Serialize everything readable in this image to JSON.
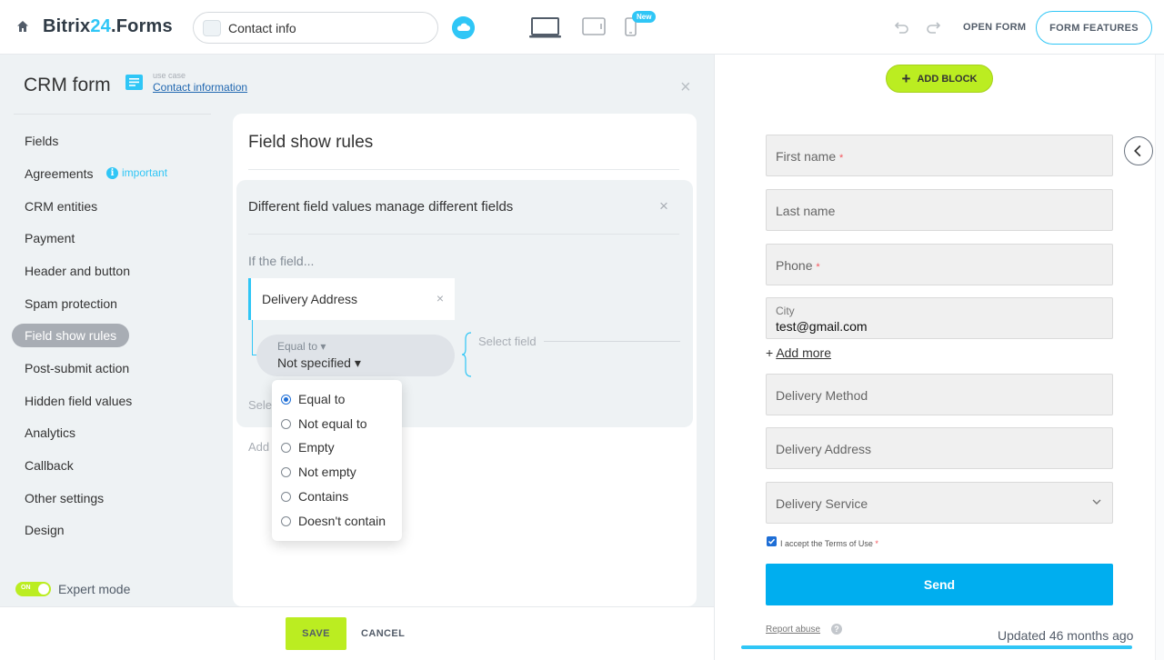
{
  "app": {
    "logo_main": "Bitrix",
    "logo_accent": "24",
    "logo_suffix": ".Forms",
    "form_name": "Contact info",
    "new_badge": "New",
    "open_form": "OPEN FORM",
    "form_features": "FORM FEATURES"
  },
  "panel": {
    "title": "CRM form",
    "usecase_label": "use case",
    "usecase_link": "Contact information",
    "close": "×"
  },
  "nav": {
    "items": [
      {
        "label": "Fields"
      },
      {
        "label": "Agreements"
      },
      {
        "label": "CRM entities"
      },
      {
        "label": "Payment"
      },
      {
        "label": "Header and button"
      },
      {
        "label": "Spam protection"
      },
      {
        "label": "Field show rules"
      },
      {
        "label": "Post-submit action"
      },
      {
        "label": "Hidden field values"
      },
      {
        "label": "Analytics"
      },
      {
        "label": "Callback"
      },
      {
        "label": "Other settings"
      },
      {
        "label": "Design"
      }
    ],
    "active_index": 6,
    "important_icon": "i",
    "important": "important",
    "expert_toggle": "ON",
    "expert_mode": "Expert mode"
  },
  "rules": {
    "title": "Field show rules",
    "block_title": "Different field values manage different fields",
    "block_close": "×",
    "if_field": "If the field...",
    "field_name": "Delivery Address",
    "field_remove": "×",
    "operator_label": "Equal to ▾",
    "operator_value": "Not specified ▾",
    "select_field": "Select field",
    "partial_select": "Sele",
    "partial_add": "Add"
  },
  "operator_menu": {
    "items": [
      "Equal to",
      "Not equal to",
      "Empty",
      "Not empty",
      "Contains",
      "Doesn't contain"
    ],
    "selected_index": 0
  },
  "footer": {
    "save": "SAVE",
    "cancel": "CANCEL"
  },
  "preview": {
    "add_block": "ADD BLOCK",
    "add_block_icon": "+",
    "fields": {
      "first_name": "First name",
      "last_name": "Last name",
      "phone": "Phone",
      "city_label": "City",
      "city_value": "test@gmail.com",
      "delivery_method": "Delivery Method",
      "delivery_address": "Delivery Address",
      "delivery_service": "Delivery Service"
    },
    "required_mark": "*",
    "add_more_icon": "+",
    "add_more": "Add more",
    "terms": "I accept the Terms of Use",
    "send": "Send",
    "report_abuse": "Report abuse",
    "help_icon": "?",
    "updated": "Updated 46 months ago"
  },
  "colors": {
    "accent": "#2fc6f6",
    "save_green": "#bbed21",
    "send_blue": "#00aeef",
    "required_red": "#f5545b"
  }
}
